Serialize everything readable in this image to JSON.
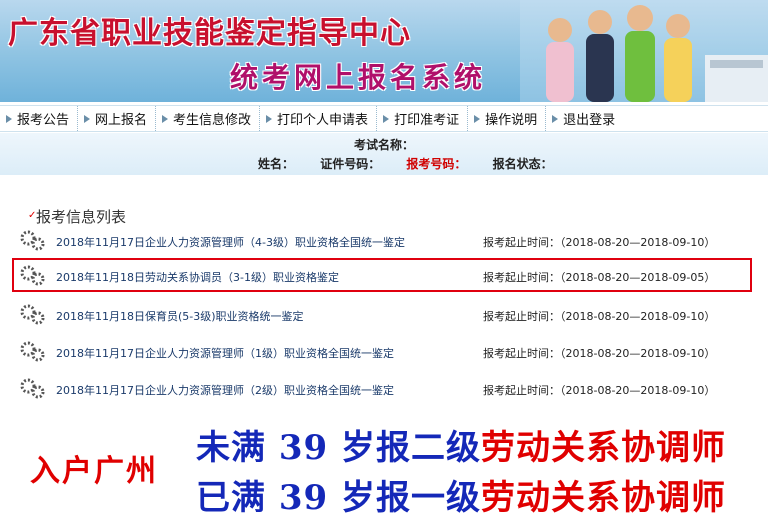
{
  "banner": {
    "title_main": "广东省职业技能鉴定指导中心",
    "title_sub": "统考网上报名系统"
  },
  "nav": {
    "items": [
      {
        "label": "报考公告"
      },
      {
        "label": "网上报名"
      },
      {
        "label": "考生信息修改"
      },
      {
        "label": "打印个人申请表"
      },
      {
        "label": "打印准考证"
      },
      {
        "label": "操作说明"
      },
      {
        "label": "退出登录"
      }
    ]
  },
  "info": {
    "exam_name_label": "考试名称：",
    "name_label": "姓名：",
    "id_label": "证件号码：",
    "exam_no_label": "报考号码：",
    "status_label": "报名状态："
  },
  "list": {
    "title": "报考信息列表",
    "items": [
      {
        "name": "2018年11月17日企业人力资源管理师（4-3级）职业资格全国统一鉴定",
        "time": "报考起止时间：（2018-08-20—2018-09-10）"
      },
      {
        "name": "2018年11月18日劳动关系协调员（3-1级）职业资格鉴定",
        "time": "报考起止时间：（2018-08-20—2018-09-05）"
      },
      {
        "name": "2018年11月18日保育员(5-3级)职业资格统一鉴定",
        "time": "报考起止时间：（2018-08-20—2018-09-10）"
      },
      {
        "name": "2018年11月17日企业人力资源管理师（1级）职业资格全国统一鉴定",
        "time": "报考起止时间：（2018-08-20—2018-09-10）"
      },
      {
        "name": "2018年11月17日企业人力资源管理师（2级）职业资格全国统一鉴定",
        "time": "报考起止时间：（2018-08-20—2018-09-10）"
      }
    ]
  },
  "slogan": {
    "left": "入户广州",
    "line1_a": "未满 39 岁报二级",
    "line1_b": "劳动关系协调师",
    "line2_a": "已满 39 岁报一级",
    "line2_b": "劳动关系协调师"
  },
  "colors": {
    "accent_red": "#e00000",
    "accent_blue": "#1428b8",
    "banner_blue": "#8ec3e2"
  }
}
